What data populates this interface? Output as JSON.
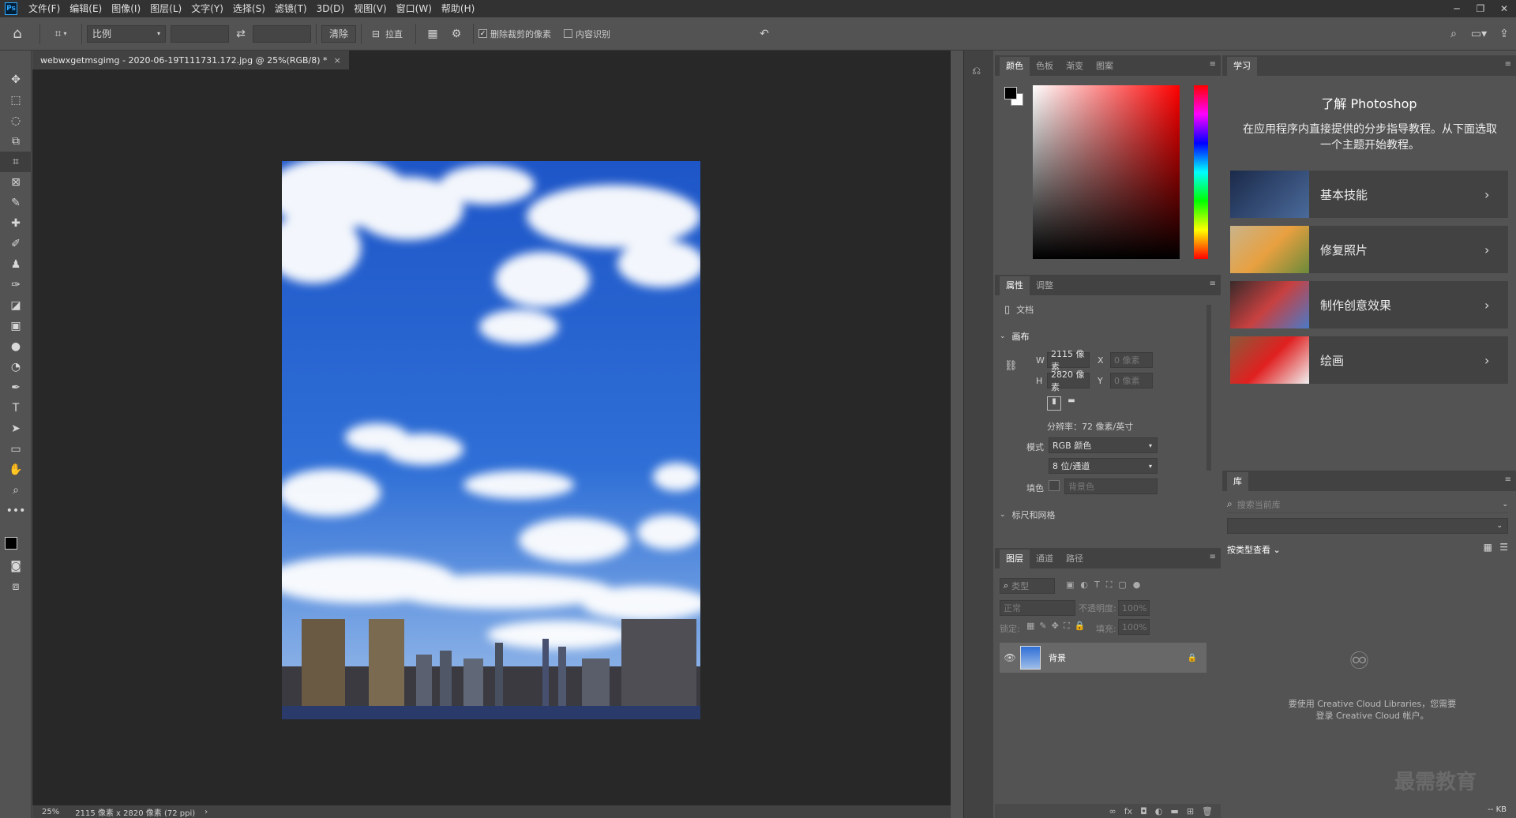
{
  "app": {
    "logo": "Ps"
  },
  "menu": [
    "文件(F)",
    "编辑(E)",
    "图像(I)",
    "图层(L)",
    "文字(Y)",
    "选择(S)",
    "滤镜(T)",
    "3D(D)",
    "视图(V)",
    "窗口(W)",
    "帮助(H)"
  ],
  "options": {
    "ratio": "比例",
    "clear": "清除",
    "straighten": "拉直",
    "delete_cropped": "删除裁剪的像素",
    "content_aware": "内容识别"
  },
  "document": {
    "tab_title": "webwxgetmsgimg - 2020-06-19T111731.172.jpg @ 25%(RGB/8) *",
    "close": "×"
  },
  "status": {
    "zoom": "25%",
    "info": "2115 像素 x 2820 像素 (72 ppi)",
    "arrow": "›"
  },
  "color_panel": {
    "tabs": [
      "颜色",
      "色板",
      "渐变",
      "图案"
    ]
  },
  "properties_panel": {
    "tabs": [
      "属性",
      "调整"
    ],
    "doc_label": "文档",
    "canvas_section": "画布",
    "w_label": "W",
    "w_value": "2115 像素",
    "h_label": "H",
    "h_value": "2820 像素",
    "x_label": "X",
    "x_value": "0 像素",
    "y_label": "Y",
    "y_value": "0 像素",
    "resolution": "分辨率：72 像素/英寸",
    "mode_label": "模式",
    "mode_value": "RGB 颜色",
    "depth_value": "8 位/通道",
    "fill_label": "填色",
    "fill_value": "背景色",
    "next_section": "标尺和网格"
  },
  "layers_panel": {
    "tabs": [
      "图层",
      "通道",
      "路径"
    ],
    "filter": "类型",
    "blend": "正常",
    "opacity_label": "不透明度:",
    "opacity_value": "100%",
    "lock_label": "锁定:",
    "fill_label": "填充:",
    "fill_value": "100%",
    "layer_name": "背景"
  },
  "learn_panel": {
    "tab": "学习",
    "title": "了解 Photoshop",
    "desc": "在应用程序内直接提供的分步指导教程。从下面选取一个主题开始教程。",
    "items": [
      "基本技能",
      "修复照片",
      "制作创意效果",
      "绘画"
    ]
  },
  "library_panel": {
    "tab": "库",
    "search_placeholder": "搜索当前库",
    "view_by": "按类型查看",
    "message": "要使用 Creative Cloud Libraries，您需要登录 Creative Cloud 帐户。",
    "size": "-- KB"
  },
  "watermark": "最需教育",
  "colors": {
    "fg": "#000000",
    "bg": "#ffffff",
    "sky": "#2f6fd6",
    "accent": "#31a8ff"
  }
}
